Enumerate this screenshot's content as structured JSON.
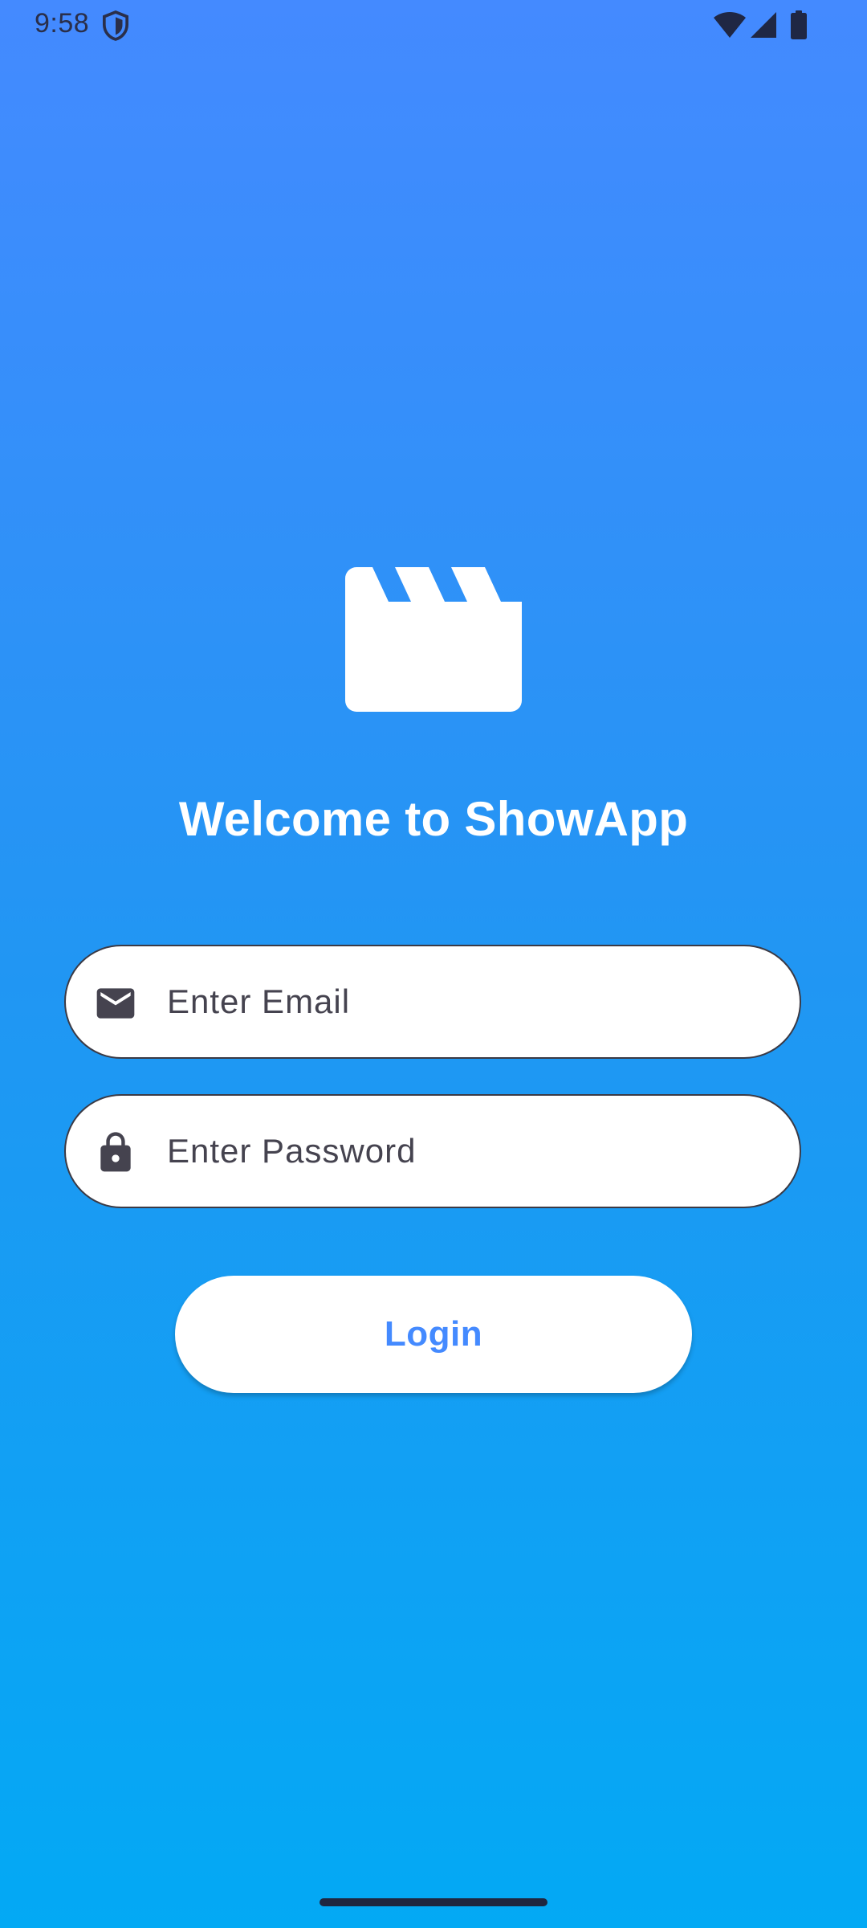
{
  "status_bar": {
    "time": "9:58",
    "icons": [
      "shield-icon",
      "wifi-icon",
      "signal-icon",
      "battery-icon"
    ],
    "color": "#2a2f4a"
  },
  "app": {
    "logo_icon": "clapperboard-icon",
    "welcome_title": "Welcome to ShowApp"
  },
  "form": {
    "email": {
      "icon": "email-icon",
      "placeholder": "Enter Email",
      "value": ""
    },
    "password": {
      "icon": "lock-icon",
      "placeholder": "Enter Password",
      "value": ""
    },
    "login_label": "Login"
  },
  "colors": {
    "gradient_top": "#448AFF",
    "gradient_bottom": "#03A9F4",
    "accent": "#448AFF",
    "input_border": "#3b3a45",
    "input_text": "#45434f"
  }
}
